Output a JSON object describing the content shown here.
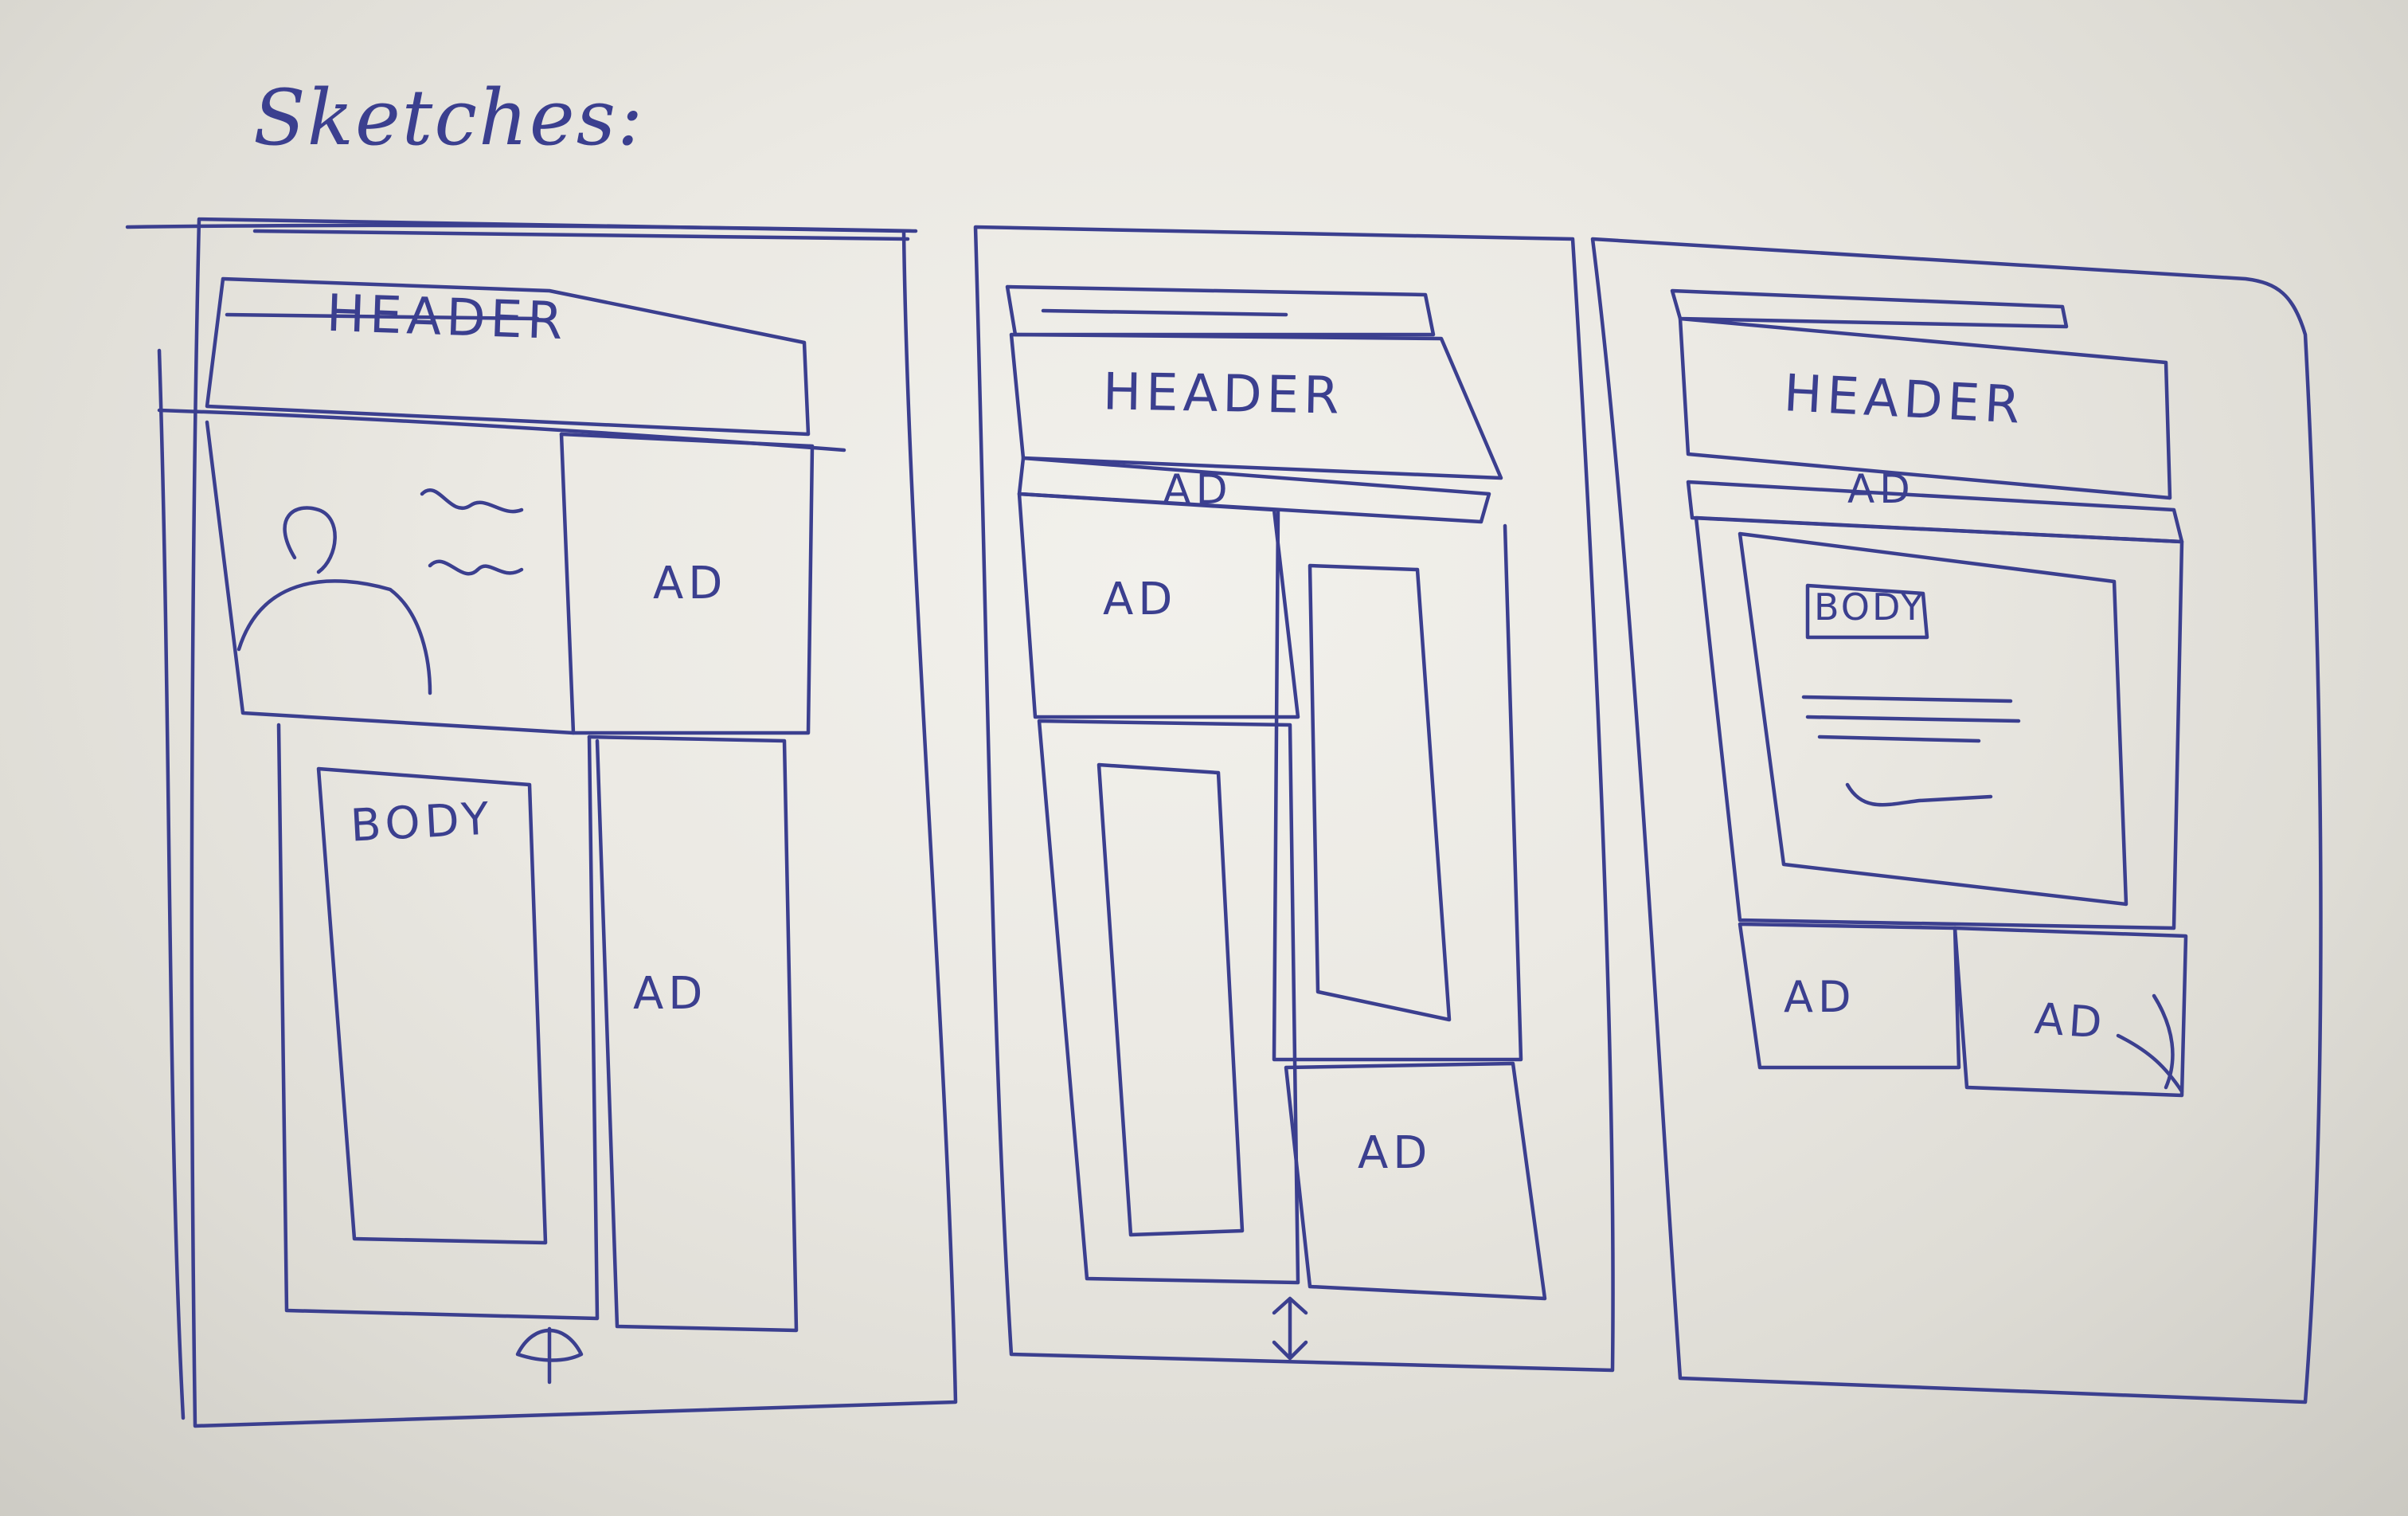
{
  "title": "Sketches:",
  "sketches": [
    {
      "header": "HEADER",
      "ads": [
        "AD",
        "AD"
      ],
      "body": "BODY"
    },
    {
      "header": "HEADER",
      "ads": [
        "AD",
        "AD",
        "AD"
      ]
    },
    {
      "header": "HEADER",
      "ads": [
        "AD",
        "AD",
        "AD"
      ],
      "body": "BODY"
    }
  ],
  "colors": {
    "ink": "#3b3f8f",
    "paper": "#ebe9e3"
  }
}
